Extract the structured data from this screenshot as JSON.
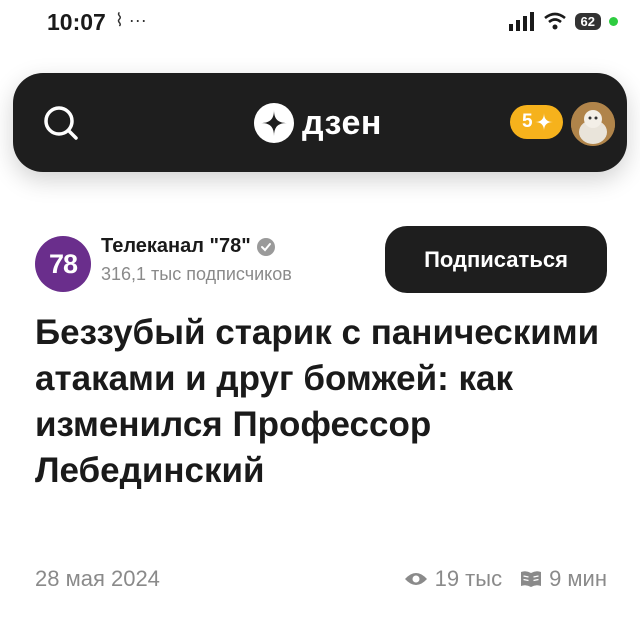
{
  "status_bar": {
    "time": "10:07",
    "left_icons": "⌇ ···",
    "battery": "62"
  },
  "header": {
    "logo_text": "дзен",
    "points": "5",
    "points_icon": "sparkle-icon"
  },
  "channel": {
    "logo_text": "78",
    "name": "Телеканал \"78\"",
    "subscribers": "316,1 тыс подписчиков",
    "subscribe_label": "Подписаться"
  },
  "article": {
    "title": "Беззубый старик с паническими атаками и друг бомжей: как изменился Профессор Лебединский",
    "date": "28 мая 2024",
    "views": "19 тыс",
    "read_time": "9 мин"
  },
  "colors": {
    "header_bg": "#1e1e1e",
    "points_badge": "#f6b21c",
    "channel_logo": "#6a2e8c",
    "muted_text": "#8a8a8a"
  }
}
